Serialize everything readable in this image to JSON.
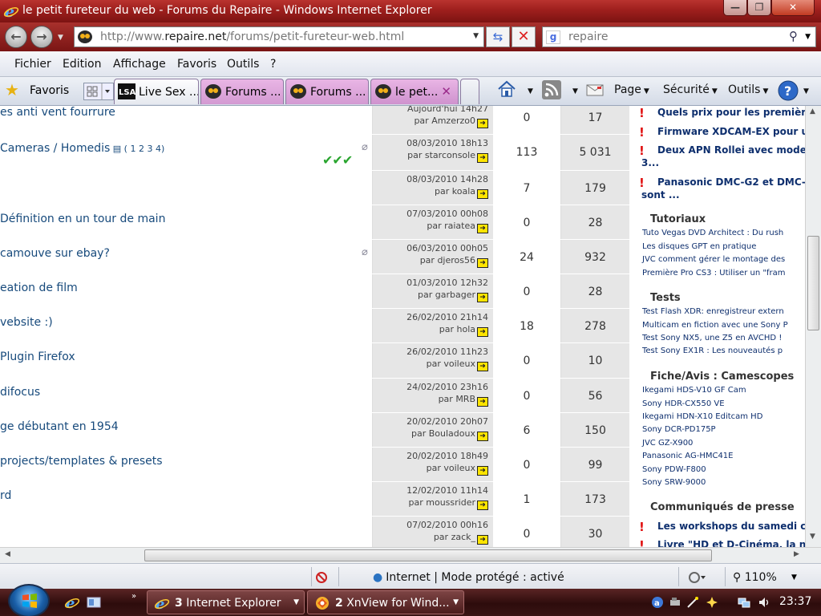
{
  "window": {
    "title": "le petit fureteur du web - Forums du Repaire - Windows Internet Explorer"
  },
  "address": {
    "url_prefix": "http://www.",
    "url_domain": "repaire.net",
    "url_path": "/forums/petit-fureteur-web.html",
    "search_text": "repaire"
  },
  "menu": [
    "Fichier",
    "Edition",
    "Affichage",
    "Favoris",
    "Outils",
    "?"
  ],
  "toolbar": {
    "favorites": "Favoris",
    "tabs": [
      "Live Sex ...",
      "Forums ...",
      "Forums ...",
      "le pet..."
    ],
    "page": "Page",
    "security": "Sécurité",
    "tools": "Outils"
  },
  "topics": [
    {
      "title": "es anti vent fourrure",
      "date": "Aujourd'hui 14h27",
      "by": "par ",
      "user": "Amzerzo0",
      "replies": "0",
      "views": "17"
    },
    {
      "title": "Cameras / Homedis",
      "pages": " ( 1 2 3 4)",
      "date": "08/03/2010 18h13",
      "by": "par ",
      "user": "starconsole",
      "replies": "113",
      "views": "5 031"
    },
    {
      "title": "",
      "date": "08/03/2010 14h28",
      "by": "par ",
      "user": "koala",
      "replies": "7",
      "views": "179"
    },
    {
      "title": "Définition en un tour de main",
      "date": "07/03/2010 00h08",
      "by": "par ",
      "user": "raiatea",
      "replies": "0",
      "views": "28"
    },
    {
      "title": "camouve sur ebay?",
      "date": "06/03/2010 00h05",
      "by": "par ",
      "user": "djeros56",
      "replies": "24",
      "views": "932"
    },
    {
      "title": "eation de film",
      "date": "01/03/2010 12h32",
      "by": "par ",
      "user": "garbager",
      "replies": "0",
      "views": "28"
    },
    {
      "title": "vebsite :)",
      "date": "26/02/2010 21h14",
      "by": "par ",
      "user": "hola",
      "replies": "18",
      "views": "278"
    },
    {
      "title": " Plugin Firefox",
      "date": "26/02/2010 11h23",
      "by": "par ",
      "user": "voileux",
      "replies": "0",
      "views": "10"
    },
    {
      "title": "difocus",
      "date": "24/02/2010 23h16",
      "by": "par ",
      "user": "MRB",
      "replies": "0",
      "views": "56"
    },
    {
      "title": "ge débutant en 1954",
      "date": "20/02/2010 20h07",
      "by": "par ",
      "user": "Bouladoux",
      "replies": "6",
      "views": "150"
    },
    {
      "title": "projects/templates & presets",
      "date": "20/02/2010 18h49",
      "by": "par ",
      "user": "voileux",
      "replies": "0",
      "views": "99"
    },
    {
      "title": "rd",
      "date": "12/02/2010 11h14",
      "by": "par ",
      "user": "moussrider",
      "replies": "1",
      "views": "173"
    },
    {
      "title": "",
      "date": "07/02/2010 00h16",
      "by": "par ",
      "user": "zack_",
      "replies": "0",
      "views": "30"
    }
  ],
  "sidebar": {
    "news_top": [
      {
        "line1": "Quels prix pour les premièr",
        "line2": ""
      },
      {
        "line1": "Firmware XDCAM-EX pour u",
        "line2": ""
      },
      {
        "line1": "Deux APN Rollei avec mode",
        "line2": "3..."
      },
      {
        "line1": "Panasonic DMC-G2 et DMC-",
        "line2": "sont ..."
      }
    ],
    "tutoriaux_heading": "Tutoriaux",
    "tutoriaux": [
      "Tuto Vegas DVD Architect : Du rush",
      "Les disques GPT en pratique",
      "JVC comment gérer le montage des",
      "Première Pro CS3 : Utiliser un \"fram"
    ],
    "tests_heading": "Tests",
    "tests": [
      "Test Flash XDR: enregistreur extern",
      "Multicam en fiction avec une Sony P",
      "Test Sony NX5, une Z5 en AVCHD !",
      "Test Sony EX1R : Les nouveautés p"
    ],
    "fiche_heading": "Fiche/Avis : Camescopes",
    "fiches": [
      "Ikegami HDS-V10 GF Cam",
      "Sony HDR-CX550 VE",
      "Ikegami HDN-X10 Editcam HD",
      "Sony DCR-PD175P",
      "JVC GZ-X900",
      "Panasonic AG-HMC41E",
      "Sony PDW-F800",
      "Sony SRW-9000"
    ],
    "press_heading": "Communiqués de presse",
    "press": [
      {
        "line1": "Les workshops du samedi c"
      },
      {
        "line1": "Livre \"HD et D-Cinéma, la n"
      }
    ]
  },
  "status": {
    "zone": "Internet | Mode protégé : activé",
    "zoom": "110%"
  },
  "taskbar": {
    "ie_count": "3",
    "ie_label": "Internet Explorer",
    "xn_count": "2",
    "xn_label": "XnView for Wind...",
    "clock": "23:37"
  }
}
